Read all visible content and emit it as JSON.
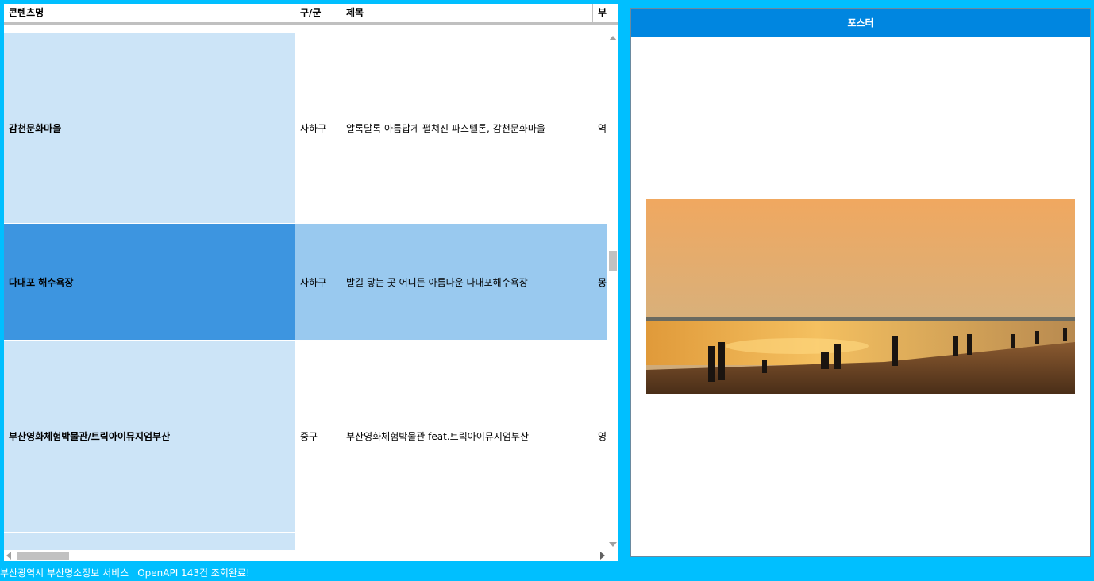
{
  "grid": {
    "columns": [
      "콘텐츠명",
      "구/군",
      "제목",
      "부"
    ],
    "rows": [
      {
        "name": "감천문화마을",
        "gu": "사하구",
        "title": "알록달록 아름답게 펼쳐진 파스텔톤, 감천문화마을",
        "extra": "역"
      },
      {
        "name": "다대포 해수욕장",
        "gu": "사하구",
        "title": "발길 닿는 곳 어디든 아름다운 다대포해수욕장",
        "extra": "몽"
      },
      {
        "name": "부산영화체험박물관/트릭아이뮤지엄부산",
        "gu": "중구",
        "title": "부산영화체험박물관 feat.트릭아이뮤지엄부산",
        "extra": "영"
      },
      {
        "name": "",
        "gu": "",
        "title": "",
        "extra": ""
      }
    ],
    "selected_row_index": 1
  },
  "poster": {
    "header": "포스터"
  },
  "status": {
    "service": "부산광역시 부산명소정보 서비스",
    "message": "OpenAPI 143건 조회완료!"
  },
  "colors": {
    "background": "#00bfff",
    "poster_header": "#0086e0",
    "selected_name_cell": "#3d95e0",
    "selected_row": "#99c9ef",
    "name_column": "#cce4f7"
  }
}
